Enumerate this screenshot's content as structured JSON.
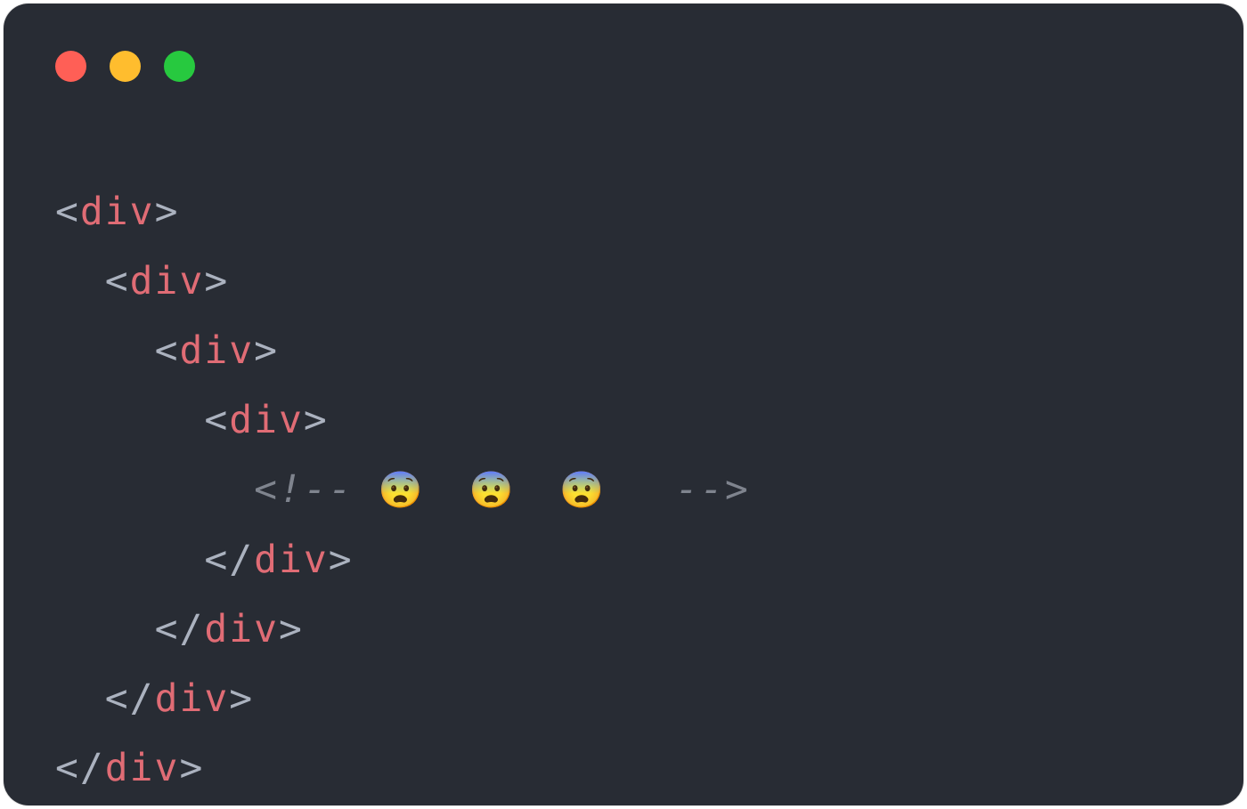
{
  "colors": {
    "background": "#282c34",
    "punct": "#abb2bf",
    "tag": "#e06c75",
    "comment": "#7f848e",
    "traffic_close": "#ff5f56",
    "traffic_minimize": "#ffbd2e",
    "traffic_zoom": "#27c93f"
  },
  "icons": {
    "close": "circle-red",
    "minimize": "circle-yellow",
    "zoom": "circle-green"
  },
  "code": {
    "l0_open_pre": "<",
    "l0_open_tag": "div",
    "l0_open_post": ">",
    "l1_indent": "  ",
    "l1_open_pre": "<",
    "l1_open_tag": "div",
    "l1_open_post": ">",
    "l2_indent": "    ",
    "l2_open_pre": "<",
    "l2_open_tag": "div",
    "l2_open_post": ">",
    "l3_indent": "      ",
    "l3_open_pre": "<",
    "l3_open_tag": "div",
    "l3_open_post": ">",
    "l4_indent": "        ",
    "l4_comment_open": "<!-- ",
    "l4_comment_content": "😨 😨 😨 ",
    "l4_comment_close": " -->",
    "l5_indent": "      ",
    "l5_close_pre": "</",
    "l5_close_tag": "div",
    "l5_close_post": ">",
    "l6_indent": "    ",
    "l6_close_pre": "</",
    "l6_close_tag": "div",
    "l6_close_post": ">",
    "l7_indent": "  ",
    "l7_close_pre": "</",
    "l7_close_tag": "div",
    "l7_close_post": ">",
    "l8_close_pre": "</",
    "l8_close_tag": "div",
    "l8_close_post": ">"
  }
}
